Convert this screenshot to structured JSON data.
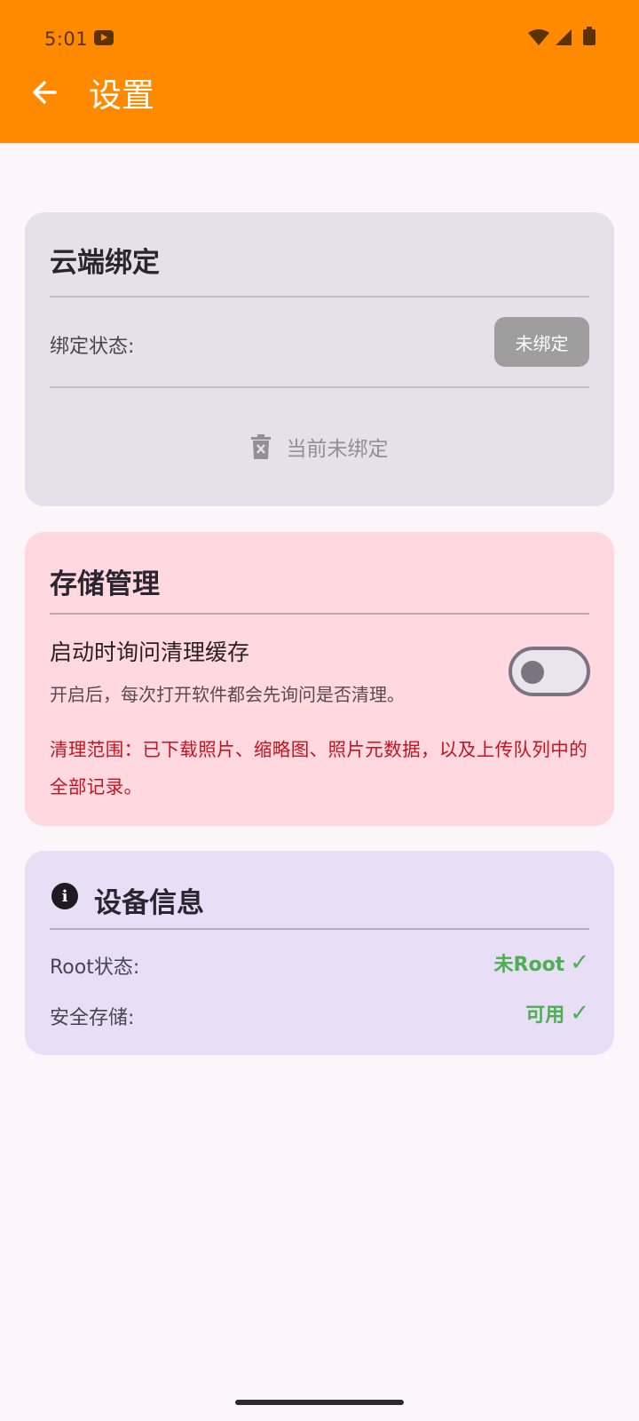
{
  "status_bar": {
    "time": "5:01"
  },
  "header": {
    "title": "设置"
  },
  "cloud": {
    "title": "云端绑定",
    "status_label": "绑定状态:",
    "status_chip": "未绑定",
    "action_label": "当前未绑定"
  },
  "storage": {
    "title": "存储管理",
    "switch_title": "启动时询问清理缓存",
    "switch_desc": "开启后，每次打开软件都会先询问是否清理。",
    "switch_on": false,
    "warning": "清理范围：已下载照片、缩略图、照片元数据，以及上传队列中的全部记录。"
  },
  "device": {
    "title": "设备信息",
    "rows": [
      {
        "label": "Root状态:",
        "value": "未Root",
        "check": "✓"
      },
      {
        "label": "安全存储:",
        "value": "可用",
        "check": "✓"
      }
    ]
  },
  "colors": {
    "appbar": "#FF8A00",
    "ok": "#4CAF50",
    "warning": "#C4131E"
  }
}
